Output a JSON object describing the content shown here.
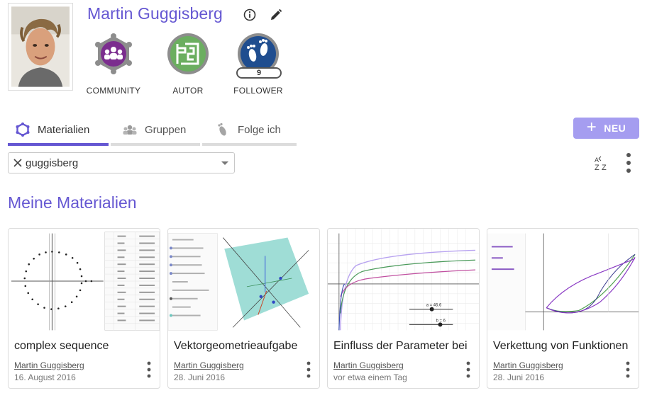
{
  "profile": {
    "name": "Martin Guggisberg",
    "avatar": "avatar-photo",
    "info_icon": "info-icon",
    "edit_icon": "pencil-icon"
  },
  "badges": [
    {
      "label": "COMMUNITY",
      "icon": "community-icon",
      "color": "#7b2d8e"
    },
    {
      "label": "AUTOR",
      "icon": "author-icon",
      "color": "#6bae60"
    },
    {
      "label": "FOLLOWER",
      "icon": "footprints-icon",
      "color": "#1f4d8f",
      "count": "9"
    }
  ],
  "tabs": [
    {
      "label": "Materialien",
      "icon": "materials-icon",
      "active": true
    },
    {
      "label": "Gruppen",
      "icon": "groups-icon",
      "active": false
    },
    {
      "label": "Folge ich",
      "icon": "footprint-icon",
      "active": false
    }
  ],
  "new_button": {
    "label": "NEU",
    "icon": "plus-icon"
  },
  "filter": {
    "value": "guggisberg",
    "clear_icon": "close-icon",
    "dropdown_icon": "caret-down-icon"
  },
  "toolbar": {
    "sort_icon": "sort-az-icon",
    "more_icon": "more-vert-icon"
  },
  "section": {
    "title": "Meine Materialien"
  },
  "cards": [
    {
      "title": "complex sequence",
      "author": "Martin Guggisberg",
      "date": "16. August 2016"
    },
    {
      "title": "Vektorgeometrieaufgabe",
      "author": "Martin Guggisberg",
      "date": "28. Juni 2016"
    },
    {
      "title": "Einfluss der Parameter bei",
      "author": "Martin Guggisberg",
      "date": "vor etwa einem Tag"
    },
    {
      "title": "Verkettung von Funktionen",
      "author": "Martin Guggisberg",
      "date": "28. Juni 2016"
    }
  ],
  "colors": {
    "accent": "#6557d2",
    "new_button": "#a59df0"
  }
}
